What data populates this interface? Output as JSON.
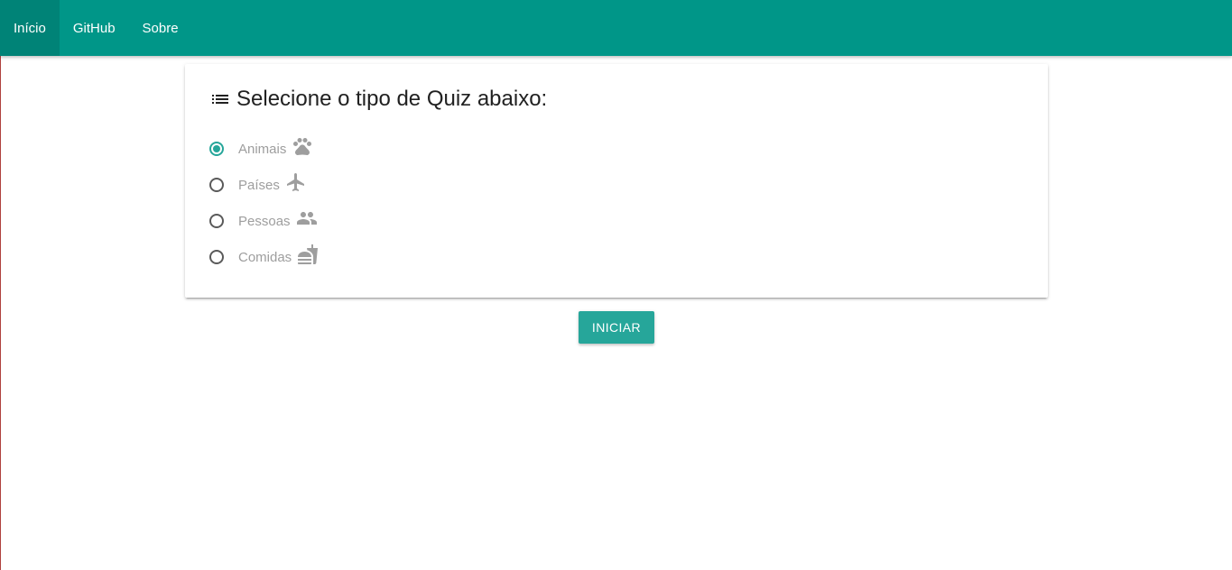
{
  "nav": {
    "items": [
      {
        "label": "Início",
        "active": true
      },
      {
        "label": "GitHub",
        "active": false
      },
      {
        "label": "Sobre",
        "active": false
      }
    ]
  },
  "card": {
    "title_icon": "list-icon",
    "title": "Selecione o tipo de Quiz abaixo:",
    "options": [
      {
        "label": "Animais",
        "icon": "paw-icon",
        "checked": true
      },
      {
        "label": "Países",
        "icon": "airplane-icon",
        "checked": false
      },
      {
        "label": "Pessoas",
        "icon": "people-icon",
        "checked": false
      },
      {
        "label": "Comidas",
        "icon": "fastfood-icon",
        "checked": false
      }
    ]
  },
  "start_button": {
    "label": "INICIAR"
  },
  "colors": {
    "navbar": "#009688",
    "accent": "#26a69a",
    "label_gray": "#9e9e9e"
  }
}
